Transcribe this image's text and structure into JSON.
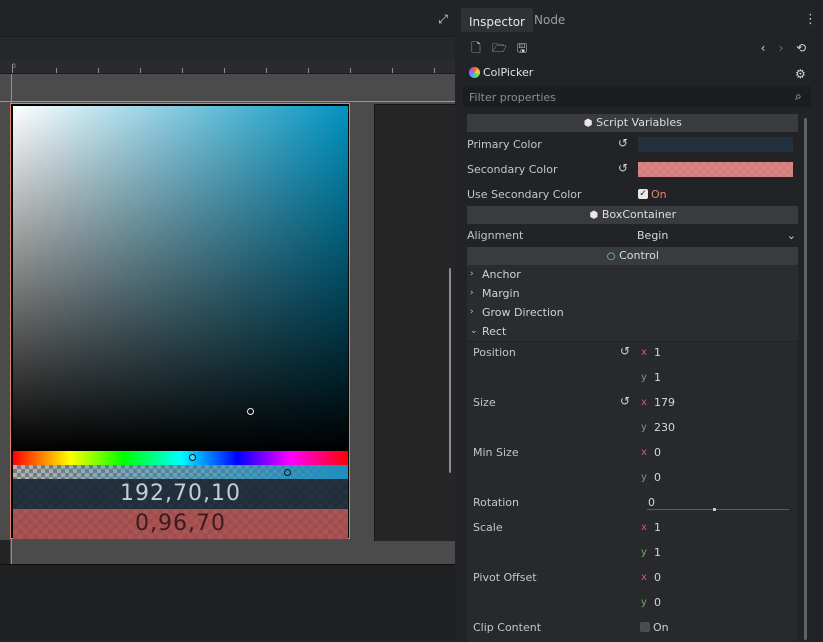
{
  "viewport": {
    "fullscreen_icon": "fullscreen-icon",
    "ruler_zero": "0",
    "colpicker": {
      "primary_text": "192,70,10",
      "secondary_text": "0,96,70",
      "hue_color": "#0093c0"
    }
  },
  "inspector": {
    "tabs": [
      "Inspector",
      "Node"
    ],
    "toolbar_icons": [
      "new-resource-icon",
      "load-resource-icon",
      "save-resource-icon",
      "history-back-icon",
      "history-forward-icon",
      "object-history-icon"
    ],
    "node_name": "ColPicker",
    "filter_placeholder": "Filter properties",
    "sections": {
      "script_variables": "Script Variables",
      "box_container": "BoxContainer",
      "control": "Control"
    },
    "props": {
      "primary_color": "Primary Color",
      "secondary_color": "Secondary Color",
      "use_secondary_color": "Use Secondary Color",
      "use_secondary_value": "On",
      "alignment": "Alignment",
      "alignment_value": "Begin"
    },
    "groups": [
      "Anchor",
      "Margin",
      "Grow Direction",
      "Rect"
    ],
    "rect": {
      "position_label": "Position",
      "position_x": "1",
      "position_y": "1",
      "size_label": "Size",
      "size_x": "179",
      "size_y": "230",
      "min_size_label": "Min Size",
      "min_size_x": "0",
      "min_size_y": "0",
      "rotation_label": "Rotation",
      "rotation_value": "0",
      "scale_label": "Scale",
      "scale_x": "1",
      "scale_y": "1",
      "pivot_label": "Pivot Offset",
      "pivot_x": "0",
      "pivot_y": "0",
      "clip_label": "Clip Content",
      "clip_value": "On"
    },
    "axis_x": "x",
    "axis_y": "y",
    "colors": {
      "accent": "#e37f6e",
      "axis_x": "#d1596a",
      "axis_y": "#6fa56d",
      "on_secondary": "#e0866c",
      "on_clip": "#cfd2d5"
    }
  }
}
